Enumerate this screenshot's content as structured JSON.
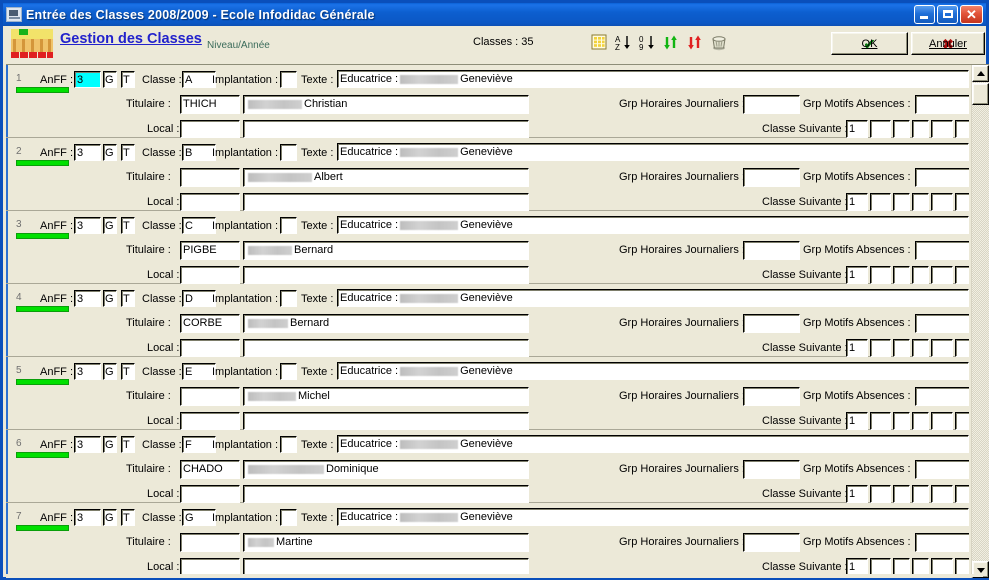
{
  "window": {
    "title": "Entrée des Classes 2008/2009  -  Ecole Infodidac Générale",
    "icon": "app-window-icon",
    "buttons": {
      "minimize": "_",
      "maximize": "□",
      "close": "✕"
    }
  },
  "header": {
    "title": "Gestion des Classes",
    "subtitle": "Niveau/Année",
    "count_label": "Classes : 35",
    "toolbar_icons": [
      "grid-table-icon",
      "sort-az-icon",
      "sort-09-icon",
      "move-up-down-green-icon",
      "move-down-up-red-icon",
      "trash-icon"
    ],
    "ok_label": "OK",
    "cancel_label": "Annuler"
  },
  "labels": {
    "anff": "AnFF :",
    "g": "G",
    "t": "T",
    "classe": "Classe :",
    "implantation": "Implantation :",
    "texte": "Texte :",
    "titulaire": "Titulaire :",
    "local": "Local :",
    "grp_horaires": "Grp Horaires Journaliers :",
    "grp_motifs": "Grp Motifs Absences :",
    "classe_suivante": "Classe Suivante :"
  },
  "rows": [
    {
      "num": "1",
      "anff": "3",
      "anff_selected": true,
      "g": "",
      "t": "",
      "classe": "A",
      "implantation": "",
      "texte_prefix": "Educatrice :",
      "texte_redacted_w": 58,
      "texte_suffix": "Geneviève",
      "titulaire_code": "THICH",
      "titulaire_redacted_w": 54,
      "titulaire_name": "Christian",
      "local_code": "",
      "local_name": "",
      "grp_horaires": "",
      "grp_motifs": "",
      "classe_suivante": [
        "1",
        "",
        "",
        "",
        "",
        ""
      ]
    },
    {
      "num": "2",
      "anff": "3",
      "anff_selected": false,
      "g": "",
      "t": "",
      "classe": "B",
      "implantation": "",
      "texte_prefix": "Educatrice :",
      "texte_redacted_w": 58,
      "texte_suffix": "Geneviève",
      "titulaire_code": "",
      "titulaire_redacted_w": 64,
      "titulaire_name": "Albert",
      "local_code": "",
      "local_name": "",
      "grp_horaires": "",
      "grp_motifs": "",
      "classe_suivante": [
        "1",
        "",
        "",
        "",
        "",
        ""
      ]
    },
    {
      "num": "3",
      "anff": "3",
      "anff_selected": false,
      "g": "",
      "t": "",
      "classe": "C",
      "implantation": "",
      "texte_prefix": "Educatrice :",
      "texte_redacted_w": 58,
      "texte_suffix": "Geneviève",
      "titulaire_code": "PIGBE",
      "titulaire_redacted_w": 44,
      "titulaire_name": "Bernard",
      "local_code": "",
      "local_name": "",
      "grp_horaires": "",
      "grp_motifs": "",
      "classe_suivante": [
        "1",
        "",
        "",
        "",
        "",
        ""
      ]
    },
    {
      "num": "4",
      "anff": "3",
      "anff_selected": false,
      "g": "",
      "t": "",
      "classe": "D",
      "implantation": "",
      "texte_prefix": "Educatrice :",
      "texte_redacted_w": 58,
      "texte_suffix": "Geneviève",
      "titulaire_code": "CORBE",
      "titulaire_redacted_w": 40,
      "titulaire_name": "Bernard",
      "local_code": "",
      "local_name": "",
      "grp_horaires": "",
      "grp_motifs": "",
      "classe_suivante": [
        "1",
        "",
        "",
        "",
        "",
        ""
      ]
    },
    {
      "num": "5",
      "anff": "3",
      "anff_selected": false,
      "g": "",
      "t": "",
      "classe": "E",
      "implantation": "",
      "texte_prefix": "Educatrice :",
      "texte_redacted_w": 58,
      "texte_suffix": "Geneviève",
      "titulaire_code": "",
      "titulaire_redacted_w": 48,
      "titulaire_name": "Michel",
      "local_code": "",
      "local_name": "",
      "grp_horaires": "",
      "grp_motifs": "",
      "classe_suivante": [
        "1",
        "",
        "",
        "",
        "",
        ""
      ]
    },
    {
      "num": "6",
      "anff": "3",
      "anff_selected": false,
      "g": "",
      "t": "",
      "classe": "F",
      "implantation": "",
      "texte_prefix": "Educatrice :",
      "texte_redacted_w": 58,
      "texte_suffix": "Geneviève",
      "titulaire_code": "CHADO",
      "titulaire_redacted_w": 76,
      "titulaire_name": "Dominique",
      "local_code": "",
      "local_name": "",
      "grp_horaires": "",
      "grp_motifs": "",
      "classe_suivante": [
        "1",
        "",
        "",
        "",
        "",
        ""
      ]
    },
    {
      "num": "7",
      "anff": "3",
      "anff_selected": false,
      "g": "",
      "t": "",
      "classe": "G",
      "implantation": "",
      "texte_prefix": "Educatrice :",
      "texte_redacted_w": 58,
      "texte_suffix": "Geneviève",
      "titulaire_code": "",
      "titulaire_redacted_w": 26,
      "titulaire_name": "Martine",
      "local_code": "",
      "local_name": "",
      "grp_horaires": "",
      "grp_motifs": "",
      "classe_suivante": [
        "1",
        "",
        "",
        "",
        "",
        ""
      ]
    }
  ],
  "colors": {
    "title_bar": "#0b57c4",
    "window_bg": "#ece9d8",
    "accent_link": "#2222cc",
    "selection": "#00ffff",
    "status_green": "#00e000",
    "row_marker": "#2a6fd0"
  }
}
